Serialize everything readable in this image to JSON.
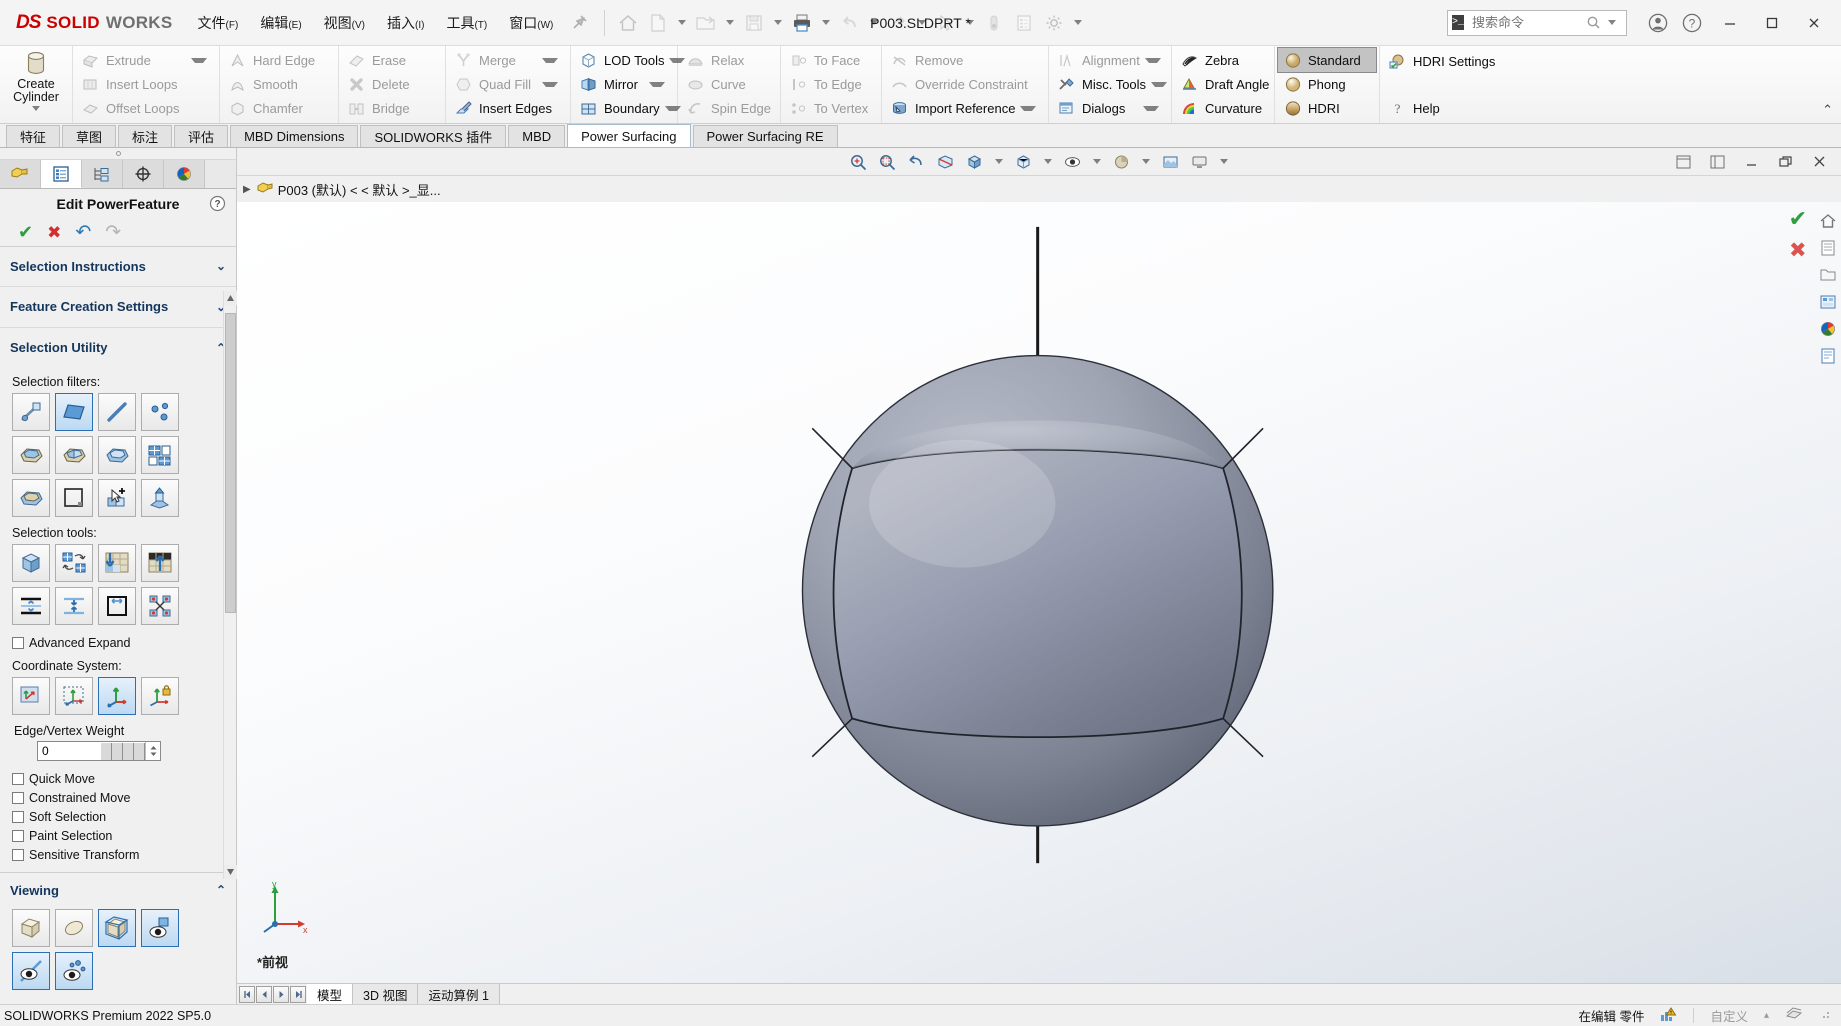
{
  "app": {
    "brand_ds": "DS",
    "brand_solid": "SOLID",
    "brand_works": "WORKS",
    "document_title": "P003.SLDPRT *",
    "accent": "#cc0000",
    "highlight": "#2b6fb5"
  },
  "menubar": {
    "items": [
      {
        "label": "文件",
        "mn": "(F)",
        "name": "menu-file"
      },
      {
        "label": "编辑",
        "mn": "(E)",
        "name": "menu-edit"
      },
      {
        "label": "视图",
        "mn": "(V)",
        "name": "menu-view"
      },
      {
        "label": "插入",
        "mn": "(I)",
        "name": "menu-insert"
      },
      {
        "label": "工具",
        "mn": "(T)",
        "name": "menu-tools"
      },
      {
        "label": "窗口",
        "mn": "(W)",
        "name": "menu-window"
      }
    ],
    "pin_icon": "pin-icon"
  },
  "quickaccess": {
    "buttons": [
      {
        "name": "home-icon",
        "enabled": false
      },
      {
        "name": "new-document-icon",
        "enabled": false
      },
      {
        "name": "open-folder-icon",
        "enabled": false
      },
      {
        "name": "save-icon",
        "enabled": false
      },
      {
        "name": "print-icon",
        "enabled": true
      },
      {
        "name": "undo-icon",
        "enabled": false
      },
      {
        "name": "redo-icon",
        "enabled": false
      },
      {
        "name": "select-cursor-icon",
        "enabled": false
      },
      {
        "name": "rebuild-icon",
        "enabled": false
      },
      {
        "name": "file-properties-icon",
        "enabled": false
      },
      {
        "name": "options-gear-icon",
        "enabled": false
      }
    ]
  },
  "search": {
    "placeholder": "搜索命令",
    "prompt_glyph": ">_",
    "name": "command-search-input"
  },
  "titlebar_right": {
    "account_icon": "user-account-icon",
    "help_icon": "help-question-icon",
    "minimize": "—",
    "maximize": "❐",
    "close": "✕"
  },
  "ribbon": {
    "collapse_chevron": "⌃",
    "groups": [
      {
        "name": "group-create",
        "big_button": {
          "label_line1": "Create",
          "label_line2": "Cylinder",
          "icon": "cylinder-icon",
          "name": "create-cylinder-button",
          "has_dropdown": true
        }
      },
      {
        "name": "group-extrude",
        "items": [
          {
            "label": "Extrude",
            "icon": "extrude-icon",
            "enabled": false,
            "dropdown": true,
            "name": "extrude-button"
          },
          {
            "label": "Insert Loops",
            "icon": "insert-loops-icon",
            "enabled": false,
            "dropdown": false,
            "name": "insert-loops-button"
          },
          {
            "label": "Offset Loops",
            "icon": "offset-loops-icon",
            "enabled": false,
            "dropdown": false,
            "name": "offset-loops-button"
          }
        ]
      },
      {
        "name": "group-edge",
        "items": [
          {
            "label": "Hard Edge",
            "icon": "hard-edge-icon",
            "enabled": false,
            "dropdown": false,
            "name": "hard-edge-button"
          },
          {
            "label": "Smooth",
            "icon": "smooth-icon",
            "enabled": false,
            "dropdown": false,
            "name": "smooth-button"
          },
          {
            "label": "Chamfer",
            "icon": "chamfer-icon",
            "enabled": false,
            "dropdown": false,
            "name": "chamfer-button"
          }
        ]
      },
      {
        "name": "group-erase",
        "items": [
          {
            "label": "Erase",
            "icon": "erase-icon",
            "enabled": false,
            "dropdown": false,
            "name": "erase-button"
          },
          {
            "label": "Delete",
            "icon": "delete-x-icon",
            "enabled": false,
            "dropdown": false,
            "name": "delete-button"
          },
          {
            "label": "Bridge",
            "icon": "bridge-icon",
            "enabled": false,
            "dropdown": false,
            "name": "bridge-button"
          }
        ]
      },
      {
        "name": "group-merge",
        "items": [
          {
            "label": "Merge",
            "icon": "merge-icon",
            "enabled": false,
            "dropdown": true,
            "name": "merge-button"
          },
          {
            "label": "Quad Fill",
            "icon": "quad-fill-icon",
            "enabled": false,
            "dropdown": true,
            "name": "quad-fill-button"
          },
          {
            "label": "Insert Edges",
            "icon": "insert-edges-icon",
            "enabled": true,
            "dropdown": false,
            "name": "insert-edges-button"
          }
        ]
      },
      {
        "name": "group-lod",
        "items": [
          {
            "label": "LOD Tools",
            "icon": "lod-tools-icon",
            "enabled": true,
            "dropdown": true,
            "name": "lod-tools-button"
          },
          {
            "label": "Mirror",
            "icon": "mirror-icon",
            "enabled": true,
            "dropdown": true,
            "name": "mirror-button"
          },
          {
            "label": "Boundary",
            "icon": "boundary-icon",
            "enabled": true,
            "dropdown": true,
            "name": "boundary-button"
          }
        ]
      },
      {
        "name": "group-relax",
        "items": [
          {
            "label": "Relax",
            "icon": "relax-iron-icon",
            "enabled": false,
            "dropdown": false,
            "name": "relax-button"
          },
          {
            "label": "Curve",
            "icon": "curve-icon",
            "enabled": false,
            "dropdown": false,
            "name": "curve-button"
          },
          {
            "label": "Spin Edge",
            "icon": "spin-edge-icon",
            "enabled": false,
            "dropdown": false,
            "name": "spin-edge-button"
          }
        ]
      },
      {
        "name": "group-constrain",
        "items": [
          {
            "label": "To Face",
            "icon": "to-face-icon",
            "enabled": false,
            "dropdown": false,
            "name": "to-face-button"
          },
          {
            "label": "To Edge",
            "icon": "to-edge-icon",
            "enabled": false,
            "dropdown": false,
            "name": "to-edge-button"
          },
          {
            "label": "To Vertex",
            "icon": "to-vertex-icon",
            "enabled": false,
            "dropdown": false,
            "name": "to-vertex-button"
          }
        ]
      },
      {
        "name": "group-reference",
        "items": [
          {
            "label": "Remove",
            "icon": "remove-icon",
            "enabled": false,
            "dropdown": false,
            "name": "remove-button"
          },
          {
            "label": "Override Constraint",
            "icon": "override-constraint-icon",
            "enabled": false,
            "dropdown": false,
            "name": "override-constraint-button"
          },
          {
            "label": "Import Reference",
            "icon": "import-reference-icon",
            "enabled": true,
            "dropdown": true,
            "name": "import-reference-button"
          }
        ]
      },
      {
        "name": "group-tools",
        "items": [
          {
            "label": "Alignment",
            "icon": "alignment-icon",
            "enabled": false,
            "dropdown": true,
            "name": "alignment-button"
          },
          {
            "label": "Misc. Tools",
            "icon": "misc-tools-icon",
            "enabled": true,
            "dropdown": true,
            "name": "misc-tools-button"
          },
          {
            "label": "Dialogs",
            "icon": "dialogs-icon",
            "enabled": true,
            "dropdown": true,
            "name": "dialogs-button"
          }
        ]
      },
      {
        "name": "group-display-left",
        "items": [
          {
            "label": "Zebra",
            "icon": "zebra-stripes-icon",
            "enabled": true,
            "dropdown": false,
            "name": "zebra-button"
          },
          {
            "label": "Draft Angle",
            "icon": "draft-angle-icon",
            "enabled": true,
            "dropdown": false,
            "name": "draft-angle-button"
          },
          {
            "label": "Curvature",
            "icon": "curvature-icon",
            "enabled": true,
            "dropdown": false,
            "name": "curvature-button"
          }
        ]
      },
      {
        "name": "group-display-right",
        "items": [
          {
            "label": "Standard",
            "icon": "standard-sphere-icon",
            "enabled": true,
            "selected": true,
            "dropdown": false,
            "name": "standard-button"
          },
          {
            "label": "Phong",
            "icon": "phong-sphere-icon",
            "enabled": true,
            "dropdown": false,
            "name": "phong-button"
          },
          {
            "label": "HDRI",
            "icon": "hdri-sphere-icon",
            "enabled": true,
            "dropdown": false,
            "name": "hdri-button"
          }
        ]
      },
      {
        "name": "group-settings",
        "items": [
          {
            "label": "HDRI Settings",
            "icon": "hdri-settings-icon",
            "enabled": true,
            "dropdown": false,
            "name": "hdri-settings-button"
          },
          {
            "label": "Help",
            "icon": "help-icon",
            "enabled": true,
            "dropdown": false,
            "name": "help-button"
          }
        ]
      }
    ]
  },
  "tabstrip": {
    "tabs": [
      {
        "label": "特征",
        "active": false,
        "name": "tab-features"
      },
      {
        "label": "草图",
        "active": false,
        "name": "tab-sketch"
      },
      {
        "label": "标注",
        "active": false,
        "name": "tab-annotation"
      },
      {
        "label": "评估",
        "active": false,
        "name": "tab-evaluate"
      },
      {
        "label": "MBD Dimensions",
        "active": false,
        "name": "tab-mbd-dimensions"
      },
      {
        "label": "SOLIDWORKS 插件",
        "active": false,
        "name": "tab-solidworks-addins"
      },
      {
        "label": "MBD",
        "active": false,
        "name": "tab-mbd"
      },
      {
        "label": "Power Surfacing",
        "active": true,
        "name": "tab-power-surfacing"
      },
      {
        "label": "Power Surfacing RE",
        "active": false,
        "name": "tab-power-surfacing-re"
      }
    ]
  },
  "leftpanel": {
    "tabs": [
      {
        "name": "feature-tree-tab",
        "icon": "feature-manager-icon",
        "active": false
      },
      {
        "name": "property-manager-tab",
        "icon": "property-manager-icon",
        "active": true
      },
      {
        "name": "config-manager-tab",
        "icon": "configuration-manager-icon",
        "active": false
      },
      {
        "name": "dimxpert-tab",
        "icon": "dimxpert-icon",
        "active": false
      },
      {
        "name": "display-manager-tab",
        "icon": "display-manager-icon",
        "active": false
      }
    ],
    "title": "Edit PowerFeature",
    "help_icon": "help-question-icon",
    "actions": [
      {
        "name": "accept-checkmark-button",
        "glyph": "✔",
        "color": "#2e9e3e",
        "enabled": true
      },
      {
        "name": "cancel-x-button",
        "glyph": "✖",
        "color": "#d32f2f",
        "enabled": true
      },
      {
        "name": "undo-button",
        "glyph": "↶",
        "color": "#2a7ab5",
        "enabled": true
      },
      {
        "name": "redo-button",
        "glyph": "↷",
        "color": "#b0b0b0",
        "enabled": false
      }
    ],
    "sections": [
      {
        "title": "Selection Instructions",
        "expanded": false,
        "name": "section-selection-instructions"
      },
      {
        "title": "Feature Creation Settings",
        "expanded": false,
        "name": "section-feature-creation-settings"
      },
      {
        "title": "Selection Utility",
        "expanded": true,
        "name": "section-selection-utility"
      }
    ],
    "selection_filters_label": "Selection filters:",
    "selection_filters": [
      {
        "name": "filter-all-entities-icon",
        "selected": false
      },
      {
        "name": "filter-face-icon",
        "selected": true
      },
      {
        "name": "filter-edge-icon",
        "selected": false
      },
      {
        "name": "filter-vertex-icon",
        "selected": false
      },
      {
        "name": "filter-open-box-top-icon",
        "selected": false
      },
      {
        "name": "filter-open-box-split-icon",
        "selected": false
      },
      {
        "name": "filter-open-box-blue-icon",
        "selected": false
      },
      {
        "name": "filter-quad-grid-icon",
        "selected": false
      },
      {
        "name": "filter-closed-box-icon",
        "selected": false
      },
      {
        "name": "filter-rectangle-outline-icon",
        "selected": false
      },
      {
        "name": "filter-paint-select-icon",
        "selected": false
      },
      {
        "name": "filter-extrude-up-icon",
        "selected": false
      }
    ],
    "selection_tools_label": "Selection tools:",
    "selection_tools": [
      {
        "name": "tool-select-all-cube-icon",
        "selected": false
      },
      {
        "name": "tool-invert-selection-icon",
        "selected": false
      },
      {
        "name": "tool-grow-down-icon",
        "selected": false
      },
      {
        "name": "tool-grow-up-icon",
        "selected": false
      },
      {
        "name": "tool-expand-vertical-icon",
        "selected": false
      },
      {
        "name": "tool-contract-vertical-icon",
        "selected": false
      },
      {
        "name": "tool-loop-select-icon",
        "selected": false
      },
      {
        "name": "tool-scatter-select-icon",
        "selected": false
      }
    ],
    "advanced_expand": {
      "label": "Advanced Expand",
      "checked": false,
      "name": "advanced-expand-checkbox"
    },
    "coordinate_system_label": "Coordinate System:",
    "coordinate_systems": [
      {
        "name": "cs-screen-icon",
        "selected": false
      },
      {
        "name": "cs-dashed-icon",
        "selected": false
      },
      {
        "name": "cs-world-icon",
        "selected": true
      },
      {
        "name": "cs-locked-icon",
        "selected": false
      }
    ],
    "edge_vertex_weight": {
      "label": "Edge/Vertex Weight",
      "value": "0",
      "name": "edge-vertex-weight-slider"
    },
    "checkboxes": [
      {
        "label": "Quick Move",
        "checked": false,
        "name": "quick-move-checkbox"
      },
      {
        "label": "Constrained Move",
        "checked": false,
        "name": "constrained-move-checkbox"
      },
      {
        "label": "Soft Selection",
        "checked": false,
        "name": "soft-selection-checkbox"
      },
      {
        "label": "Paint Selection",
        "checked": false,
        "name": "paint-selection-checkbox"
      },
      {
        "label": "Sensitive Transform",
        "checked": false,
        "name": "sensitive-transform-checkbox"
      }
    ],
    "viewing": {
      "title": "Viewing",
      "expanded": true,
      "buttons": [
        {
          "name": "view-box-shaded-icon",
          "selected": false
        },
        {
          "name": "view-ellipse-icon",
          "selected": false
        },
        {
          "name": "view-cage-box-icon",
          "selected": true
        },
        {
          "name": "view-eye-face-icon",
          "selected": true
        },
        {
          "name": "view-eye-edge-icon",
          "selected": true
        },
        {
          "name": "view-eye-vertex-icon",
          "selected": true
        }
      ]
    }
  },
  "viewport": {
    "tree_item": "P003 (默认) < < 默认 >_显...",
    "tree_expand_icon": "expand-triangle-icon",
    "tree_part_icon": "part-document-icon",
    "toolbar_center": [
      {
        "name": "zoom-to-fit-icon"
      },
      {
        "name": "zoom-area-icon"
      },
      {
        "name": "previous-view-icon"
      },
      {
        "name": "section-view-icon"
      },
      {
        "name": "view-orientation-icon"
      },
      {
        "name": "display-style-icon"
      },
      {
        "name": "hide-show-icon"
      },
      {
        "name": "edit-appearance-icon"
      },
      {
        "name": "apply-scene-icon"
      },
      {
        "name": "view-settings-icon"
      }
    ],
    "toolbar_right": [
      {
        "name": "tile-horizontally-icon"
      },
      {
        "name": "tile-vertically-icon"
      },
      {
        "name": "window-minimize-icon"
      },
      {
        "name": "window-restore-icon"
      },
      {
        "name": "window-close-icon"
      }
    ],
    "side_icons": [
      {
        "name": "view-home-icon"
      },
      {
        "name": "view-list-icon"
      },
      {
        "name": "view-folder-icon"
      },
      {
        "name": "view-appearances-icon"
      },
      {
        "name": "view-scenes-icon"
      },
      {
        "name": "view-decals-icon"
      }
    ],
    "confirm_corner": [
      {
        "name": "confirm-ok-icon",
        "glyph": "✔",
        "color": "#2e9e3e"
      },
      {
        "name": "confirm-cancel-icon",
        "glyph": "✖",
        "color": "#d9534f"
      }
    ],
    "triad": {
      "x_label": "x",
      "y_label": "y",
      "name": "origin-triad"
    },
    "view_label": "*前视",
    "model": {
      "name": "sphere-power-surface-model",
      "description": "Shaded grey sphere with quad surface edges and vertical axis line"
    }
  },
  "bottom": {
    "nav_buttons": [
      {
        "name": "nav-first-icon",
        "glyph": "|◀"
      },
      {
        "name": "nav-prev-icon",
        "glyph": "◀"
      },
      {
        "name": "nav-next-icon",
        "glyph": "▶"
      },
      {
        "name": "nav-last-icon",
        "glyph": "▶|"
      }
    ],
    "tabs": [
      {
        "label": "模型",
        "active": true,
        "name": "bottom-tab-model"
      },
      {
        "label": "3D 视图",
        "active": false,
        "name": "bottom-tab-3d-view"
      },
      {
        "label": "运动算例 1",
        "active": false,
        "name": "bottom-tab-motion-study"
      }
    ]
  },
  "statusbar": {
    "left": "SOLIDWORKS Premium 2022 SP5.0",
    "editing": "在编辑 零件",
    "warning_icon": "warning-chart-icon",
    "custom": "自定义",
    "custom_caret": "▴",
    "overlay_icon": "overlay-icon",
    "resize_grip": "resize-grip-icon"
  }
}
